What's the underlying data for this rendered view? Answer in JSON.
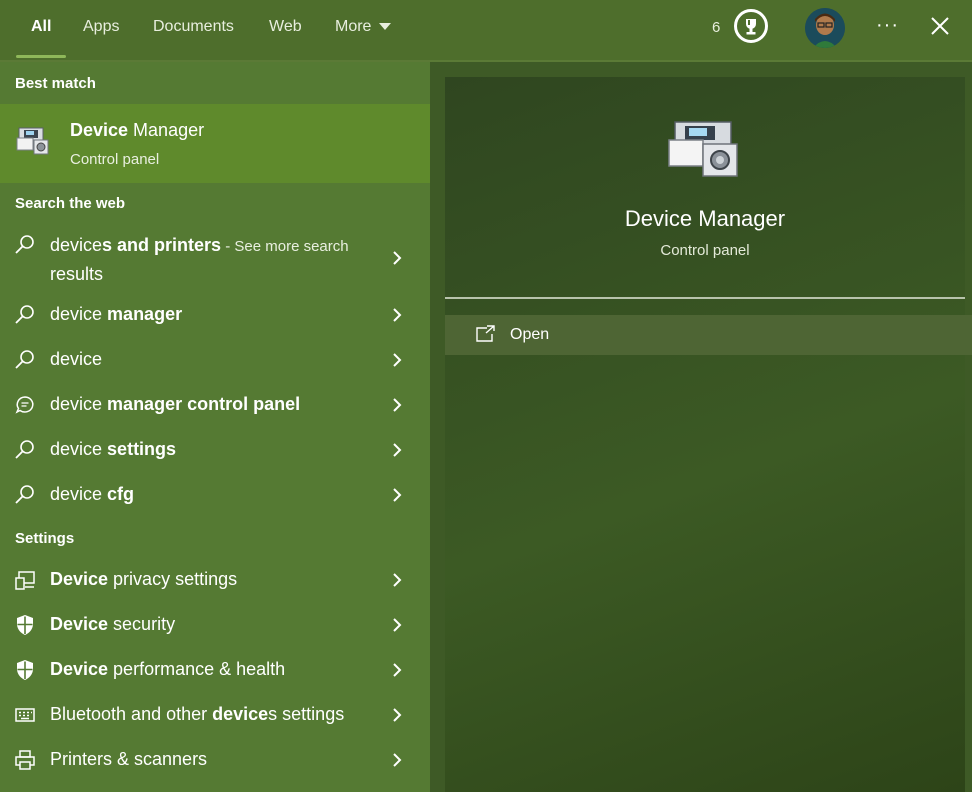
{
  "tabs": [
    "All",
    "Apps",
    "Documents",
    "Web",
    "More"
  ],
  "rewards": {
    "points": "6"
  },
  "left": {
    "best_match_heading": "Best match",
    "best_match": {
      "title_bold": "Device",
      "title_rest": " Manager",
      "subtitle": "Control panel"
    },
    "web_heading": "Search the web",
    "web_results": [
      {
        "prefix": "device",
        "bold": "s and printers",
        "suffix": "",
        "hint": " - See more search",
        "hint2": "results",
        "icon": "search-icon"
      },
      {
        "prefix": "device ",
        "bold": "manager",
        "suffix": "",
        "icon": "search-icon"
      },
      {
        "prefix": "device",
        "bold": "",
        "suffix": "",
        "icon": "search-icon"
      },
      {
        "prefix": "device ",
        "bold": "manager control panel",
        "suffix": "",
        "icon": "chat-icon"
      },
      {
        "prefix": "device ",
        "bold": "settings",
        "suffix": "",
        "icon": "search-icon"
      },
      {
        "prefix": "device ",
        "bold": "cfg",
        "suffix": "",
        "icon": "search-icon"
      }
    ],
    "settings_heading": "Settings",
    "settings_results": [
      {
        "bold_first": "Device",
        "rest": " privacy settings",
        "icon": "devices-icon"
      },
      {
        "bold_first": "Device",
        "rest": " security",
        "icon": "shield-icon"
      },
      {
        "bold_first": "Device",
        "rest": " performance & health",
        "icon": "shield-icon"
      },
      {
        "pre": "Bluetooth and other ",
        "bold_mid": "device",
        "post": "s settings",
        "icon": "keyboard-icon"
      },
      {
        "pre": "Printers & scanners",
        "icon": "printer-icon"
      }
    ]
  },
  "preview": {
    "title": "Device Manager",
    "subtitle": "Control panel",
    "open_label": "Open"
  },
  "colors": {
    "accent": "#8fb85a",
    "best_match_bg": "#5f8a2c",
    "panel_bg": "#557a33"
  }
}
